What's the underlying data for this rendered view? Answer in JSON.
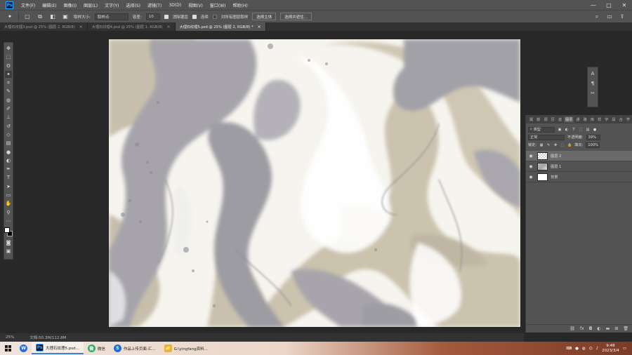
{
  "menu": {
    "logo": "Ps",
    "items": [
      "文件(F)",
      "编辑(E)",
      "图像(I)",
      "图层(L)",
      "文字(Y)",
      "选择(S)",
      "滤镜(T)",
      "3D(D)",
      "视图(V)",
      "窗口(W)",
      "帮助(H)"
    ],
    "window_controls": [
      "—",
      "□",
      "✕"
    ]
  },
  "options": {
    "sample_size_label": "取样大小:",
    "sample_size_value": "取样点",
    "tolerance_label": "容差:",
    "tolerance_value": "10",
    "antialias_label": "消除锯齿",
    "contiguous_label": "连续",
    "sample_all_label": "对所有图层取样",
    "select_subject": "选择主体",
    "select_and_mask": "选择并遮住..."
  },
  "tabs": [
    {
      "label": "大理石纹理3.psd @ 25% (图层 2, RGB/8)",
      "close": "×"
    },
    {
      "label": "大理石纹理4.psd @ 25% (图层 1, RGB/8)",
      "close": "×"
    },
    {
      "label": "大理石纹理5.psd @ 25% (图层 2, RGB/8) *",
      "close": "×"
    }
  ],
  "status": {
    "zoom": "25%",
    "doc_info": "文档:50.3M/112.8M"
  },
  "layers_panel": {
    "tabs": [
      "属",
      "颜",
      "调",
      "历",
      "迹",
      "图层",
      "通",
      "路",
      "库",
      "样",
      "字",
      "段",
      "合",
      "学"
    ],
    "active_tab": "图层",
    "filter_kind": "类型",
    "blend_mode": "正常",
    "opacity_label": "不透明度:",
    "opacity_value": "39%",
    "lock_label": "锁定:",
    "fill_label": "填充:",
    "fill_value": "100%",
    "layers": [
      {
        "name": "图层 2",
        "selected": true
      },
      {
        "name": "图层 1",
        "selected": false
      },
      {
        "name": "背景",
        "selected": false
      }
    ]
  },
  "taskbar": {
    "apps": [
      {
        "label": "",
        "icon": "W"
      },
      {
        "label": "大理石纹理5.psd...",
        "icon": "Ps"
      },
      {
        "label": "微信",
        "icon": "微"
      },
      {
        "label": "作品上传页面-汇...",
        "icon": "S"
      },
      {
        "label": "G:\\yingfang资料...",
        "icon": "📁"
      }
    ],
    "time": "9:48",
    "date": "2023/3/4"
  },
  "colors": {
    "marble_beige": "#c9c1ad",
    "marble_gray": "#a4a2a8",
    "marble_white": "#ffffff",
    "accent_blue": "#31a8ff"
  }
}
